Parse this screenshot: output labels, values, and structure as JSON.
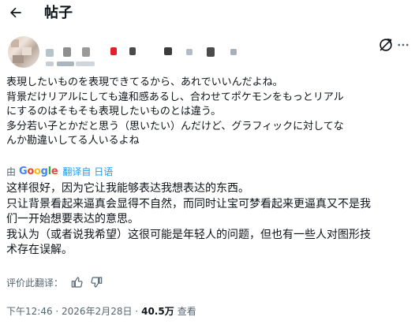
{
  "header": {
    "title": "帖子",
    "back_icon": "back-arrow-icon"
  },
  "author": {
    "avatar_icon": "avatar",
    "grok_icon": "grok-icon",
    "more_icon": "more-icon"
  },
  "post": {
    "original_lines": [
      "表現したいものを表現できてるから、あれでいいんだよね。",
      "背景だけリアルにしても違和感あるし、合わせてポケモンをもっとリアル",
      "にするのはそもそも表現したいものとは違う。",
      "多分若い子とかだと思う（思いたい）んだけど、グラフィックに対してな",
      "んか勘違いしてる人いるよね"
    ],
    "translated_by_prefix": "由",
    "translated_by_brand": "Google",
    "translated_link": "翻译自 日语",
    "translation_lines": [
      "这样很好，因为它让我能够表达我想表达的东西。",
      "只让背景看起来逼真会显得不自然，而同时让宝可梦看起来更逼真又不是我",
      "们一开始想要表达的意思。",
      "我认为（或者说我希望）这很可能是年轻人的问题，但也有一些人对图形技",
      "术存在误解。"
    ],
    "rate_label": "评价此翻译：",
    "thumbs_up_icon": "thumbs-up-icon",
    "thumbs_down_icon": "thumbs-down-icon"
  },
  "meta": {
    "timestamp": "下午12:46 · 2026年2月28日 ·",
    "views": "40.5万",
    "views_label": "查看"
  },
  "colors": {
    "text": "#0f1419",
    "secondary": "#536471",
    "link": "#1d9bf0",
    "google_blue": "#4285f4",
    "google_red": "#ea4335",
    "google_yellow": "#fbbc05",
    "google_green": "#34a853"
  }
}
